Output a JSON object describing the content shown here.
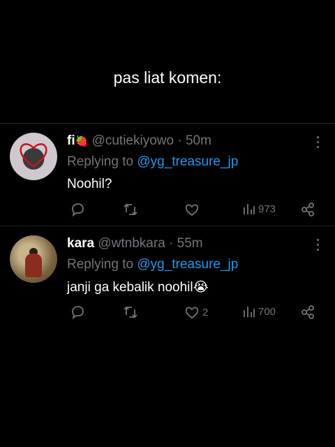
{
  "caption": "pas liat komen:",
  "tweets": [
    {
      "name": "fi",
      "emoji": "🍓",
      "handle": "@cutiekiyowo",
      "dot": "·",
      "time": "50m",
      "reply_prefix": "Replying to",
      "reply_to": "@yg_treasure_jp",
      "text": "Noohil?",
      "likes": "",
      "views": "973"
    },
    {
      "name": "kara",
      "emoji": "",
      "handle": "@wtnbkara",
      "dot": "·",
      "time": "55m",
      "reply_prefix": "Replying to",
      "reply_to": "@yg_treasure_jp",
      "text": "janji ga kebalik noohil😭",
      "likes": "2",
      "views": "700"
    }
  ],
  "icons": [
    "reply-icon",
    "retweet-icon",
    "like-icon",
    "views-icon",
    "share-icon",
    "more-icon"
  ],
  "colors": {
    "background": "#000000",
    "muted": "#71767b",
    "link": "#1d9bf0",
    "text": "#ffffff"
  }
}
